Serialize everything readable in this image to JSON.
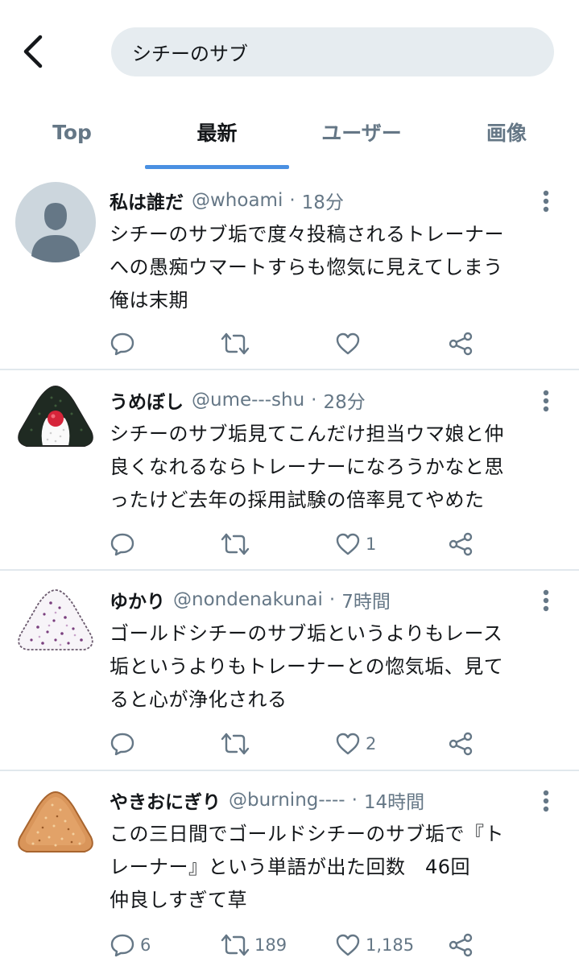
{
  "search": {
    "query": "シチーのサブ"
  },
  "tabs": [
    {
      "label": "Top",
      "active": false
    },
    {
      "label": "最新",
      "active": true
    },
    {
      "label": "ユーザー",
      "active": false
    },
    {
      "label": "画像",
      "active": false
    }
  ],
  "colors": {
    "accent": "#4a90e2",
    "muted": "#657786",
    "divider": "#e1e8ed",
    "search_bg": "#e6ecf0"
  },
  "tweets": [
    {
      "name": "私は誰だ",
      "handle": "@whoami",
      "time": "18分",
      "avatar_icon": "default-profile-icon",
      "lines": [
        "シチーのサブ垢で度々投稿されるトレーナー",
        "への愚痴ウマートすらも惚気に見えてしまう",
        "俺は末期"
      ],
      "replies": "",
      "retweets": "",
      "likes": ""
    },
    {
      "name": "うめぼし",
      "handle": "@ume---shu",
      "time": "28分",
      "avatar_icon": "umeboshi-onigiri-icon",
      "lines": [
        "シチーのサブ垢見てこんだけ担当ウマ娘と仲",
        "良くなれるならトレーナーになろうかなと思",
        "ったけど去年の採用試験の倍率見てやめた"
      ],
      "replies": "",
      "retweets": "",
      "likes": "1"
    },
    {
      "name": "ゆかり",
      "handle": "@nondenakunai",
      "time": "7時間",
      "avatar_icon": "yukari-onigiri-icon",
      "lines": [
        "ゴールドシチーのサブ垢というよりもレース",
        "垢というよりもトレーナーとの惚気垢、見て",
        "ると心が浄化される"
      ],
      "replies": "",
      "retweets": "",
      "likes": "2"
    },
    {
      "name": "やきおにぎり",
      "handle": "@burning----",
      "time": "14時間",
      "avatar_icon": "yaki-onigiri-icon",
      "lines": [
        "この三日間でゴールドシチーのサブ垢で『ト",
        "レーナー』という単語が出た回数　46回",
        "仲良しすぎて草"
      ],
      "replies": "6",
      "retweets": "189",
      "likes": "1,185"
    }
  ]
}
